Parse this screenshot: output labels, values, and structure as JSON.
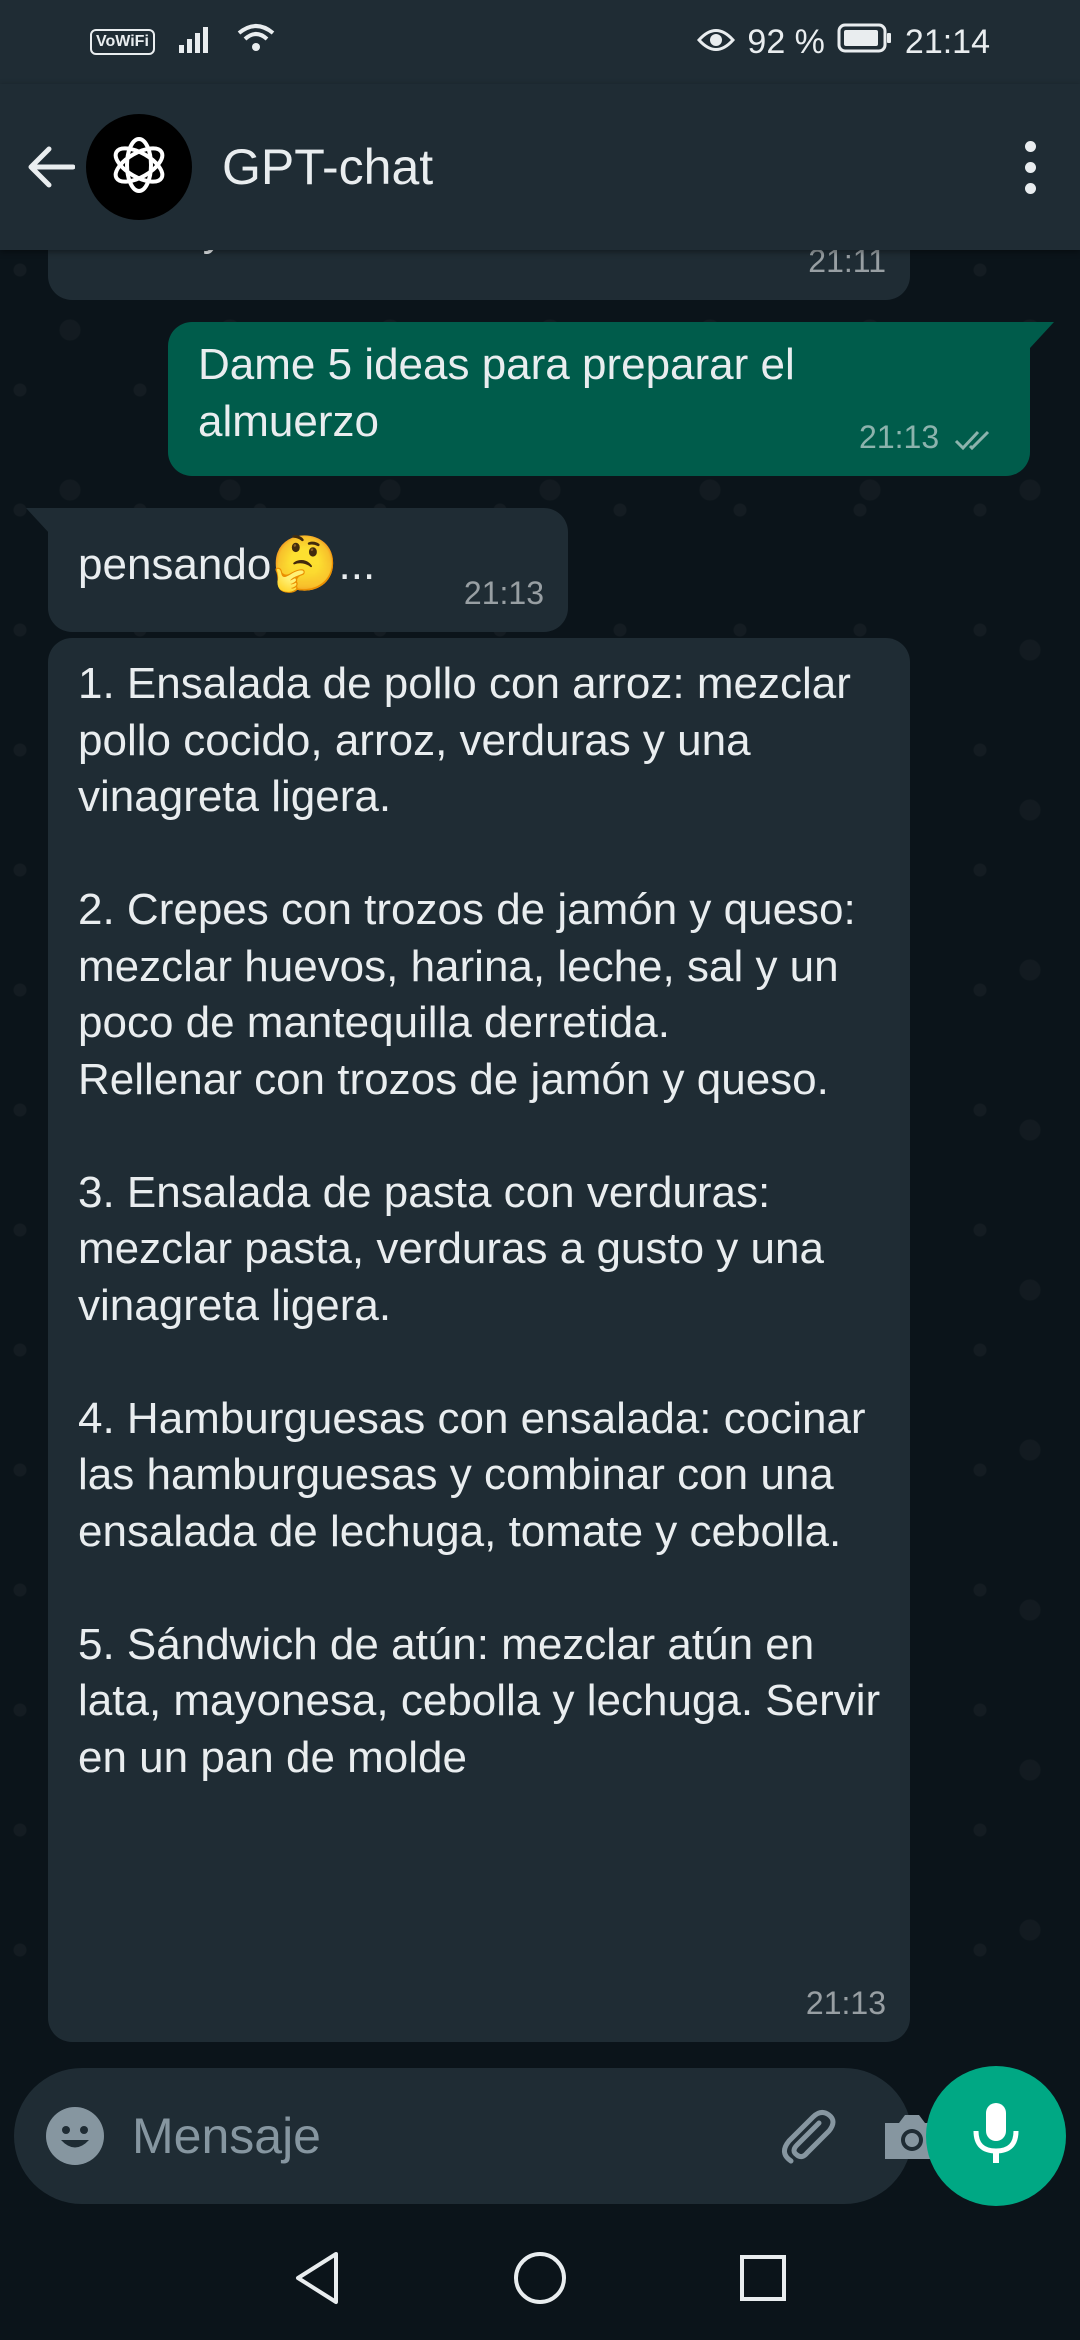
{
  "status_bar": {
    "vowifi": "VoWiFi",
    "battery": "92 %",
    "time": "21:14",
    "icons": [
      "signal-icon",
      "wifi-icon",
      "eye-icon",
      "battery-icon"
    ]
  },
  "header": {
    "title": "GPT-chat",
    "avatar_icon": "openai-logo-icon"
  },
  "messages": {
    "previous": {
      "text": "Pide ayuda cuando la neces",
      "time": "21:11"
    },
    "user": {
      "text": "Dame 5 ideas para preparar el almuerzo",
      "time": "21:13",
      "status_icon": "double-check-icon"
    },
    "thinking": {
      "text": "pensando",
      "emoji": "🤔",
      "suffix": " ...",
      "time": "21:13"
    },
    "answer": {
      "text": "1. Ensalada de pollo con arroz: mezclar pollo cocido, arroz, verduras y una vinagreta ligera.\n\n2. Crepes con trozos de jamón y queso: mezclar huevos, harina, leche, sal y un poco de mantequilla derretida.\nRellenar con trozos de jamón y queso.\n\n3. Ensalada de pasta con verduras: mezclar pasta, verduras a gusto y una vinagreta ligera.\n\n4. Hamburguesas con ensalada: cocinar las hamburguesas y combinar con una ensalada de lechuga, tomate y cebolla.\n\n5. Sándwich de atún: mezclar atún en lata, mayonesa, cebolla y lechuga. Servir en un pan de molde",
      "time": "21:13"
    }
  },
  "input": {
    "placeholder": "Mensaje",
    "icons": [
      "emoji-icon",
      "attach-icon",
      "camera-icon",
      "mic-icon"
    ]
  },
  "colors": {
    "background": "#0b141a",
    "bar": "#1f2c34",
    "outgoing": "#005c4b",
    "accent": "#00a884"
  }
}
